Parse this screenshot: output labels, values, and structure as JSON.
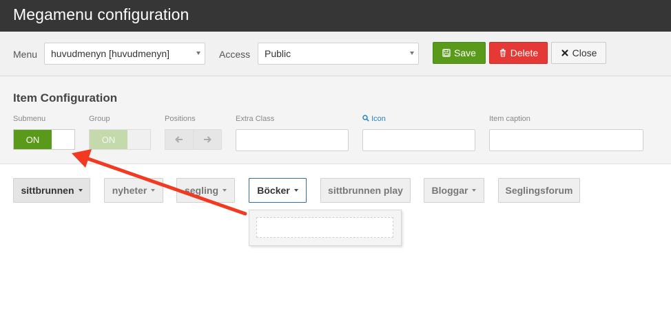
{
  "app": {
    "title": "Megamenu configuration"
  },
  "toolbar": {
    "menu_label": "Menu",
    "menu_value": "huvudmenyn [huvudmenyn]",
    "access_label": "Access",
    "access_value": "Public",
    "save_label": "Save",
    "delete_label": "Delete",
    "close_label": "Close"
  },
  "item_config": {
    "heading": "Item Configuration",
    "submenu_label": "Submenu",
    "submenu_state": "ON",
    "group_label": "Group",
    "group_state": "ON",
    "positions_label": "Positions",
    "extra_class_label": "Extra Class",
    "extra_class_value": "",
    "icon_label": "Icon",
    "icon_value": "",
    "caption_label": "Item caption",
    "caption_value": ""
  },
  "nav": {
    "items": [
      {
        "label": "sittbrunnen",
        "has_caret": true
      },
      {
        "label": "nyheter",
        "has_caret": true
      },
      {
        "label": "segling",
        "has_caret": true
      },
      {
        "label": "Böcker",
        "has_caret": true
      },
      {
        "label": "sittbrunnen play",
        "has_caret": false
      },
      {
        "label": "Bloggar",
        "has_caret": true
      },
      {
        "label": "Seglingsforum",
        "has_caret": false
      }
    ]
  },
  "colors": {
    "titlebar": "#363636",
    "save": "#5a9a1a",
    "delete": "#e53935",
    "toggle_on": "#5a9a1a",
    "toggle_disabled": "#c4d9ac",
    "link": "#2a80c4",
    "annotation_arrow": "#f23a22"
  }
}
